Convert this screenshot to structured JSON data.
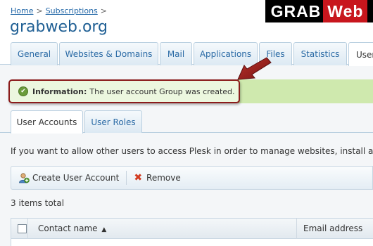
{
  "breadcrumb": {
    "home": "Home",
    "separator": ">",
    "subscriptions": "Subscriptions"
  },
  "page_title": "grabweb.org",
  "logo": {
    "part1": "GRAB",
    "part2": "Web"
  },
  "tabs": [
    {
      "label": "General"
    },
    {
      "label": "Websites & Domains"
    },
    {
      "label": "Mail"
    },
    {
      "label": "Applications"
    },
    {
      "label": "Files"
    },
    {
      "label": "Statistics"
    },
    {
      "label": "User"
    }
  ],
  "info": {
    "icon": "check-circle-icon",
    "title": "Information:",
    "message": "The user account Group was created."
  },
  "subtabs": [
    {
      "label": "User Accounts"
    },
    {
      "label": "User Roles"
    }
  ],
  "description": "If you want to allow other users to access Plesk in order to manage websites, install app",
  "toolbar": {
    "create_label": "Create User Account",
    "remove_label": "Remove"
  },
  "items_total": "3 items total",
  "table": {
    "columns": {
      "contact": "Contact name",
      "sort": "▲",
      "email": "Email address"
    }
  },
  "colors": {
    "accent": "#2a6aa5",
    "title": "#1f5f94",
    "annotation": "#8b1b1b",
    "success_bg": "#ecf7df"
  }
}
